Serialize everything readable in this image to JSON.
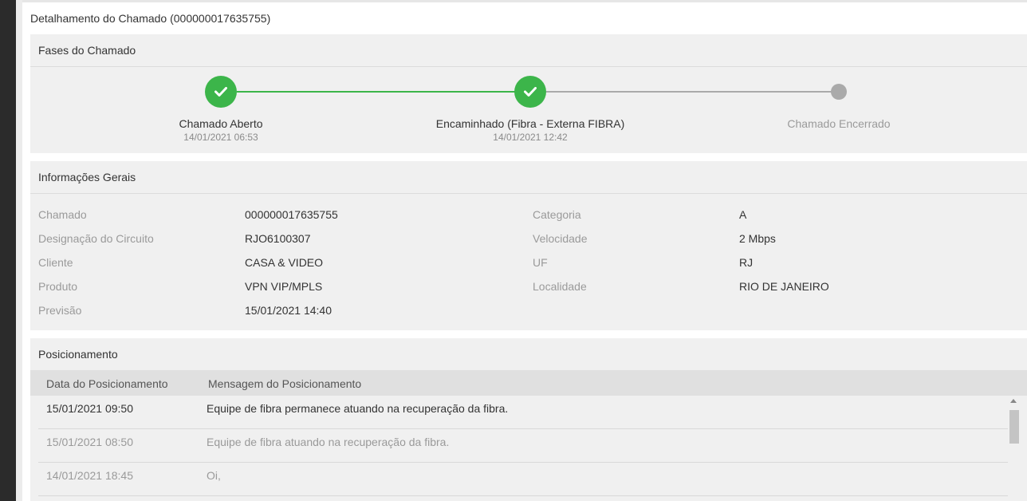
{
  "page": {
    "title": "Detalhamento do Chamado (000000017635755)"
  },
  "colors": {
    "phase_done": "#3cb54a",
    "phase_pending": "#aaaaaa"
  },
  "phases": {
    "header": "Fases do Chamado",
    "steps": [
      {
        "label": "Chamado Aberto",
        "date": "14/01/2021 06:53",
        "status": "done",
        "icon": "check-icon"
      },
      {
        "label": "Encaminhado (Fibra - Externa FIBRA)",
        "date": "14/01/2021 12:42",
        "status": "done",
        "icon": "check-icon"
      },
      {
        "label": "Chamado Encerrado",
        "date": "",
        "status": "pending",
        "icon": ""
      }
    ]
  },
  "info": {
    "header": "Informações Gerais",
    "left": [
      {
        "label": "Chamado",
        "value": "000000017635755"
      },
      {
        "label": "Designação do Circuito",
        "value": "RJO6100307"
      },
      {
        "label": "Cliente",
        "value": "CASA & VIDEO"
      },
      {
        "label": "Produto",
        "value": "VPN VIP/MPLS"
      },
      {
        "label": "Previsão",
        "value": "15/01/2021 14:40"
      }
    ],
    "right": [
      {
        "label": "Categoria",
        "value": "A"
      },
      {
        "label": "Velocidade",
        "value": "2 Mbps"
      },
      {
        "label": "UF",
        "value": "RJ"
      },
      {
        "label": "Localidade",
        "value": "RIO DE JANEIRO"
      }
    ]
  },
  "positioning": {
    "header": "Posicionamento",
    "columns": [
      "Data do Posicionamento",
      "Mensagem do Posicionamento"
    ],
    "rows": [
      {
        "date": "15/01/2021 09:50",
        "message": "Equipe de fibra permanece atuando na recuperação da fibra."
      },
      {
        "date": "15/01/2021 08:50",
        "message": "Equipe de fibra atuando na recuperação da fibra."
      },
      {
        "date": "14/01/2021 18:45",
        "message": "Oi,"
      }
    ]
  }
}
